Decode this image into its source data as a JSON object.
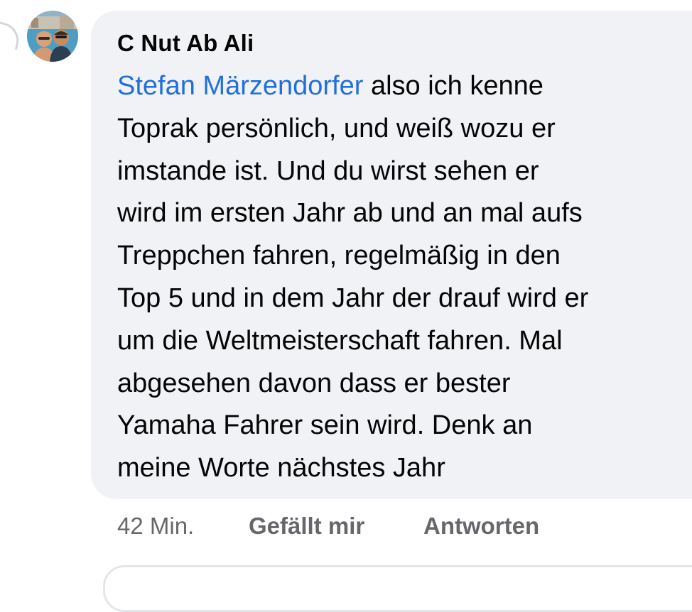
{
  "comment": {
    "author": "C Nut Ab Ali",
    "mention": "Stefan Märzendorfer",
    "lines": [
      " also ich kenne",
      "Toprak persönlich, und weiß wozu er",
      "imstande ist. Und du wirst sehen er",
      "wird im ersten Jahr ab und an mal aufs",
      "Treppchen fahren, regelmäßig in den",
      "Top 5 und in dem Jahr der drauf wird er",
      "um die Weltmeisterschaft fahren. Mal",
      "abgesehen davon dass er bester",
      "Yamaha Fahrer sein wird. Denk an",
      "meine Worte nächstes Jahr"
    ]
  },
  "actions": {
    "time": "42 Min.",
    "like_label": "Gefällt mir",
    "reply_label": "Antworten"
  },
  "colors": {
    "mention": "#216fdb",
    "bubble": "#f0f2f5",
    "meta": "#65676b"
  }
}
